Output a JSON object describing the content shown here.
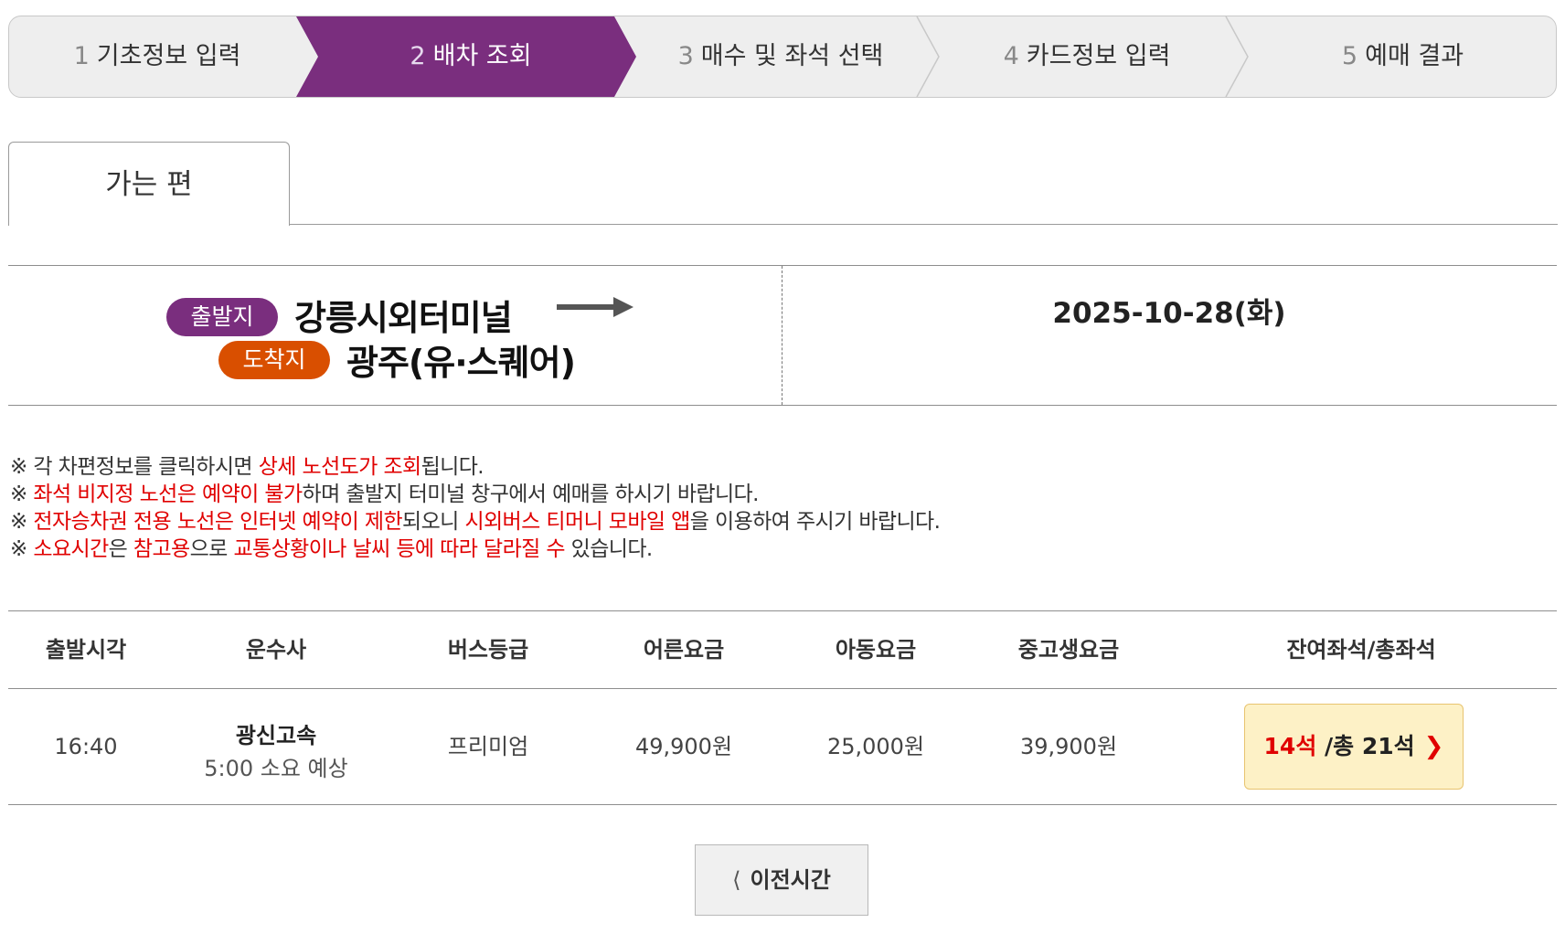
{
  "steps": [
    {
      "num": "1",
      "label": "기초정보 입력",
      "active": false
    },
    {
      "num": "2",
      "label": "배차 조회",
      "active": true
    },
    {
      "num": "3",
      "label": "매수 및 좌석 선택",
      "active": false
    },
    {
      "num": "4",
      "label": "카드정보 입력",
      "active": false
    },
    {
      "num": "5",
      "label": "예매 결과",
      "active": false
    }
  ],
  "colors": {
    "active_step": "#7a2e7e",
    "departure_badge": "#7a2e7e",
    "arrival_badge": "#d94f00",
    "highlight_red": "#e00000",
    "seat_button_bg": "#fdf1c6"
  },
  "tab": {
    "label": "가는 편"
  },
  "route": {
    "departure_badge": "출발지",
    "departure": "강릉시외터미널",
    "arrival_badge": "도착지",
    "arrival": "광주(유·스퀘어)",
    "date": "2025-10-28(화)"
  },
  "notices": {
    "n1": {
      "mark": "※ ",
      "a": "각 차편정보를 클릭하시면 ",
      "b": "상세 노선도가 조회",
      "c": "됩니다."
    },
    "n2": {
      "mark": "※ ",
      "a": "좌석 비지정 노선은 예약이 불가",
      "b": "하며 출발지 터미널 창구에서 예매를 하시기 바랍니다."
    },
    "n3": {
      "mark": "※ ",
      "a": "전자승차권 전용 노선은 인터넷 예약이 제한",
      "b": "되오니 ",
      "c": "시외버스 티머니 모바일 앱",
      "d": "을 이용하여 주시기 바랍니다."
    },
    "n4": {
      "mark": "※ ",
      "a": "소요시간",
      "b": "은 ",
      "c": "참고용",
      "d": "으로 ",
      "e": "교통상황이나 날씨 등에 따라 달라질 수",
      "f": " 있습니다."
    }
  },
  "table": {
    "headers": {
      "depart_time": "출발시각",
      "company": "운수사",
      "grade": "버스등급",
      "adult": "어른요금",
      "child": "아동요금",
      "student": "중고생요금",
      "seats": "잔여좌석/총좌석"
    },
    "rows": [
      {
        "depart_time": "16:40",
        "company": "광신고속",
        "duration": "5:00 소요 예상",
        "grade": "프리미엄",
        "adult": "49,900원",
        "child": "25,000원",
        "student": "39,900원",
        "seats_remaining": "14석",
        "seats_total": " /총 21석"
      }
    ]
  },
  "prev_button": {
    "label": "이전시간"
  }
}
